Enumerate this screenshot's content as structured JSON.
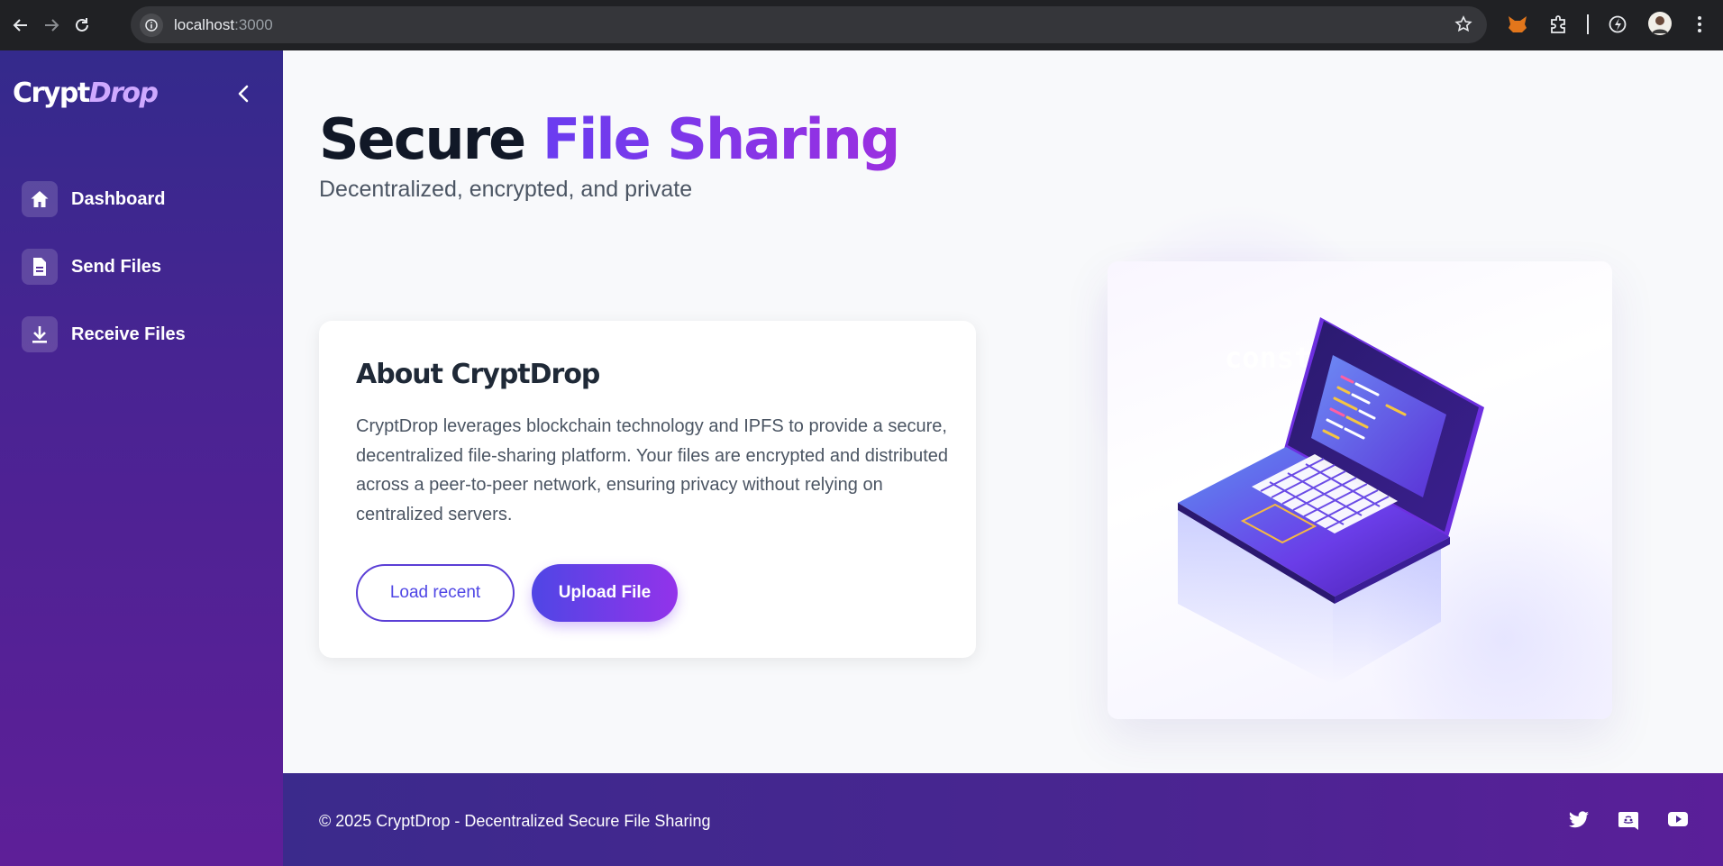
{
  "browser": {
    "url_host": "localhost",
    "url_port": ":3000"
  },
  "sidebar": {
    "brand_main": "Crypt",
    "brand_accent": "Drop",
    "items": [
      {
        "label": "Dashboard",
        "icon": "home-icon"
      },
      {
        "label": "Send Files",
        "icon": "file-icon"
      },
      {
        "label": "Receive Files",
        "icon": "download-icon"
      }
    ]
  },
  "hero": {
    "title_plain": "Secure ",
    "title_accent": "File Sharing",
    "subtitle": "Decentralized, encrypted, and private"
  },
  "about": {
    "title": "About CryptDrop",
    "text": "CryptDrop leverages blockchain technology and IPFS to provide a secure, decentralized file-sharing platform. Your files are encrypted and distributed across a peer-to-peer network, ensuring privacy without relying on centralized servers.",
    "load_label": "Load recent",
    "upload_label": "Upload File"
  },
  "footer": {
    "text": "© 2025 CryptDrop - Decentralized Secure File Sharing",
    "social": [
      "twitter-icon",
      "discord-icon",
      "youtube-icon"
    ]
  },
  "colors": {
    "accent": "#7c3aed",
    "primary": "#4f46e5",
    "sidebar": "#3b2a8c"
  }
}
